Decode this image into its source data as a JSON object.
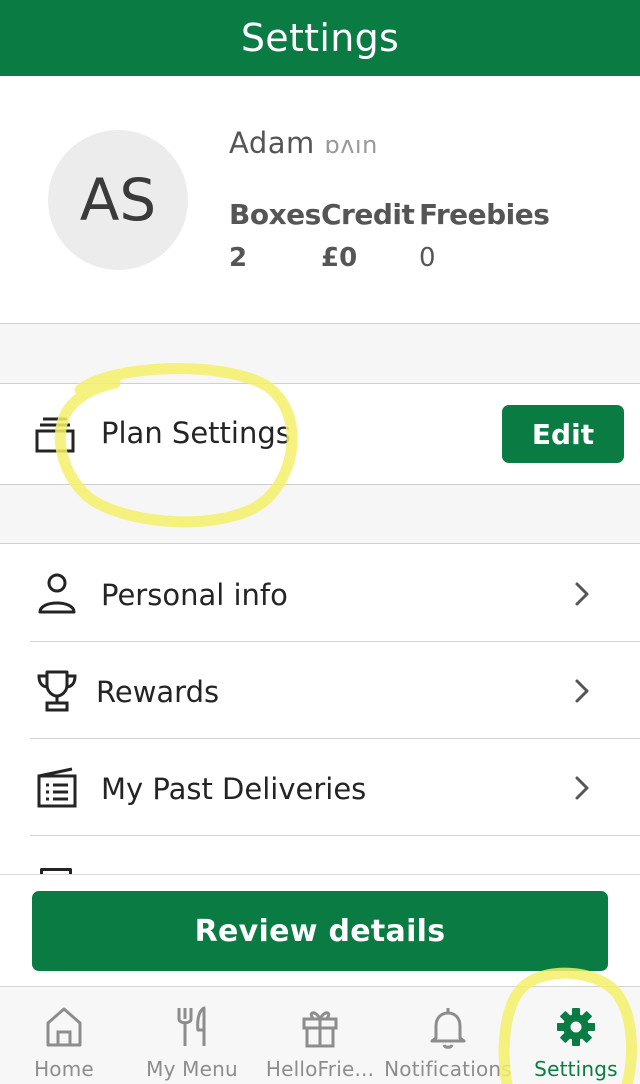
{
  "header": {
    "title": "Settings"
  },
  "profile": {
    "initials": "AS",
    "name": "Adam ",
    "name_obscured": "ɒʌın",
    "stats": [
      {
        "label": "Boxes",
        "value": "2"
      },
      {
        "label": "Credit",
        "value": "£0"
      },
      {
        "label": "Freebies",
        "value": "0"
      }
    ]
  },
  "plan": {
    "label": "Plan Settings",
    "edit_label": "Edit",
    "icon": "stack-icon"
  },
  "menu": [
    {
      "label": "Personal info",
      "icon": "person-icon"
    },
    {
      "label": "Rewards",
      "icon": "trophy-icon"
    },
    {
      "label": "My Past Deliveries",
      "icon": "deliveries-icon"
    }
  ],
  "cta": {
    "label": "Review details"
  },
  "tabbar": {
    "tabs": [
      {
        "label": "Home",
        "icon": "home-icon",
        "active": false
      },
      {
        "label": "My Menu",
        "icon": "fork-knife-icon",
        "active": false
      },
      {
        "label": "HelloFrie...",
        "icon": "gift-icon",
        "active": false
      },
      {
        "label": "Notifications",
        "icon": "bell-icon",
        "active": false
      },
      {
        "label": "Settings",
        "icon": "gear-icon",
        "active": true
      }
    ]
  },
  "colors": {
    "brand": "#0a7c43",
    "annotation": "#f5f06a",
    "inactive_tab": "#8d8d8d"
  }
}
